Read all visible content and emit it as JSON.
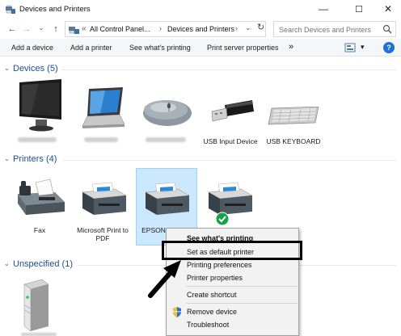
{
  "window": {
    "title": "Devices and Printers",
    "minimize_glyph": "—",
    "maximize_glyph": "☐",
    "close_glyph": "✕"
  },
  "address": {
    "back_glyph": "←",
    "forward_glyph": "→",
    "dropdown_glyph": "⌄",
    "up_glyph": "↑",
    "prefix": "«",
    "crumb1": "All Control Panel...",
    "crumb2": "Devices and Printers",
    "sep": "›",
    "refresh_glyph": "↻",
    "search_placeholder": "Search Devices and Printers"
  },
  "toolbar": {
    "add_device": "Add a device",
    "add_printer": "Add a printer",
    "see_printing": "See what's printing",
    "server_props": "Print server properties",
    "more": "»",
    "view_dropdown": "▾",
    "help": "?"
  },
  "groups": {
    "devices": "Devices (5)",
    "printers": "Printers (4)",
    "unspecified": "Unspecified (1)",
    "chevron": "⌄"
  },
  "devices": [
    {
      "label": "",
      "icon": "monitor-icon"
    },
    {
      "label": "",
      "icon": "laptop-icon"
    },
    {
      "label": "",
      "icon": "mouse-icon"
    },
    {
      "label": "USB Input Device",
      "icon": "usb-dongle-icon"
    },
    {
      "label": "USB KEYBOARD",
      "icon": "keyboard-icon"
    }
  ],
  "printers": [
    {
      "label": "Fax",
      "icon": "fax-icon"
    },
    {
      "label": "Microsoft Print to PDF",
      "icon": "printer-icon"
    },
    {
      "label": "EPSON",
      "icon": "printer-icon",
      "selected": true
    },
    {
      "label": "",
      "icon": "printer-icon",
      "default": true
    }
  ],
  "unspecified": [
    {
      "label": "",
      "icon": "server-icon"
    }
  ],
  "context_menu": {
    "see_printing": "See what's printing",
    "set_default": "Set as default printer",
    "preferences": "Printing preferences",
    "properties": "Printer properties",
    "shortcut": "Create shortcut",
    "remove": "Remove device",
    "troubleshoot": "Troubleshoot"
  },
  "colors": {
    "accent": "#1c4f8a",
    "selection": "#cce8ff",
    "default_check": "#14a34a"
  }
}
